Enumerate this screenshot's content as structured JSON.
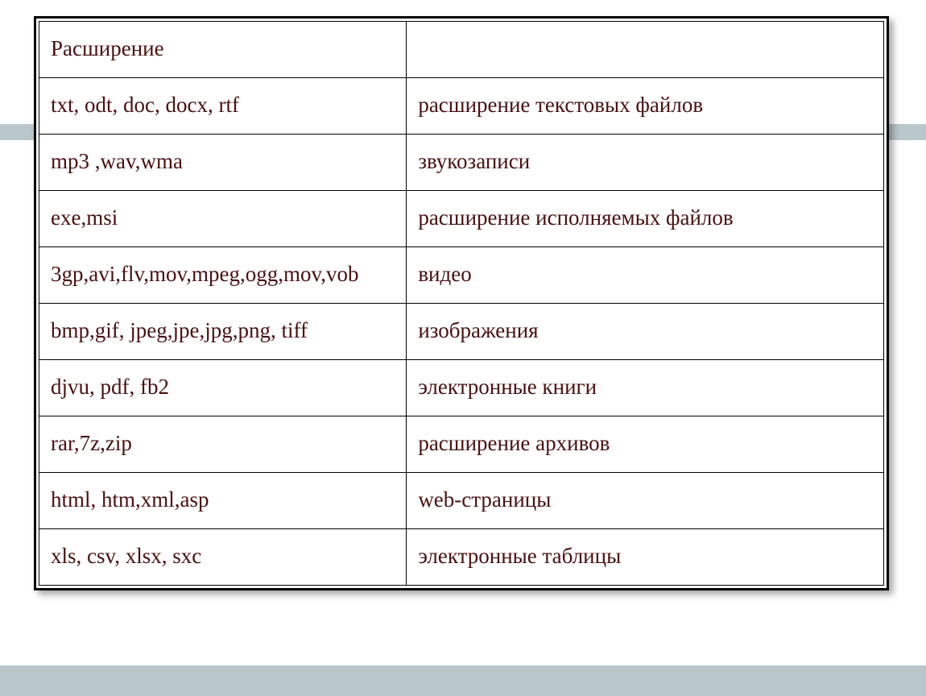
{
  "table": {
    "header": {
      "col1": "Расширение",
      "col2": ""
    },
    "rows": [
      {
        "ext": "txt, odt, doc, docx, rtf",
        "desc": "расширение текстовых файлов"
      },
      {
        "ext": "mp3 ,wav,wma",
        "desc": "звукозаписи"
      },
      {
        "ext": "exe,msi",
        "desc": "расширение исполняемых файлов"
      },
      {
        "ext": "3gp,avi,flv,mov,mpeg,ogg,mov,vob",
        "desc": " видео"
      },
      {
        "ext": "bmp,gif, jpeg,jpe,jpg,png, tiff",
        "desc": "изображения"
      },
      {
        "ext": "djvu, pdf, fb2",
        "desc": "электронные книги"
      },
      {
        "ext": "rar,7z,zip",
        "desc": "расширение архивов"
      },
      {
        "ext": "html, htm,xml,asp",
        "desc": "web-страницы"
      },
      {
        "ext": "xls, csv, xlsx, sxc",
        "desc": "электронные таблицы"
      }
    ]
  }
}
